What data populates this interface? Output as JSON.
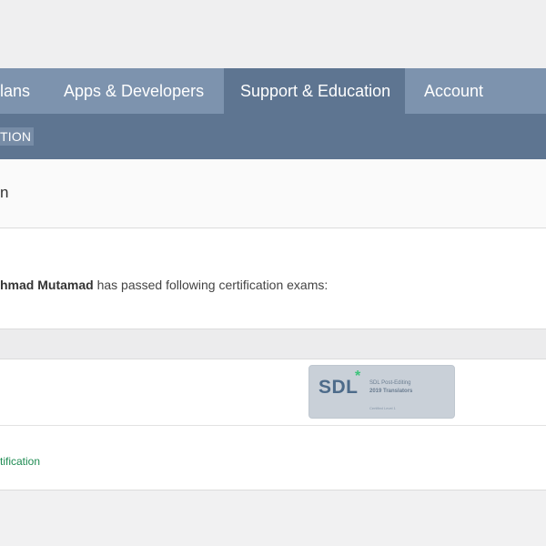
{
  "nav": {
    "items": [
      {
        "label": "lans"
      },
      {
        "label": "Apps & Developers"
      },
      {
        "label": "Support & Education"
      },
      {
        "label": "Account"
      }
    ],
    "active_index": 2
  },
  "subnav": {
    "label": "TION"
  },
  "section": {
    "title": "n"
  },
  "intro": {
    "name": "hmad Mutamad",
    "text": " has passed following certification exams:"
  },
  "certificate": {
    "badge": {
      "logo": "SDL",
      "plus": "*",
      "line1": "SDL Post-Editing",
      "line2": "2019 Translators",
      "line3": "Certified Level 1"
    }
  },
  "link": {
    "label": "tification"
  },
  "colors": {
    "nav_bg": "#7d93ae",
    "nav_active": "#5e7591",
    "link": "#1e8b52"
  }
}
